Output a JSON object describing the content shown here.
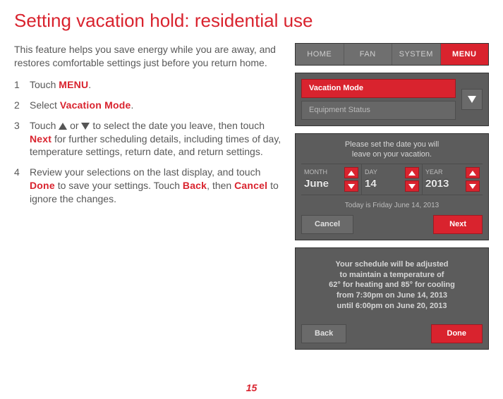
{
  "title": "Setting vacation hold: residential use",
  "intro": "This feature helps you save energy while you are away, and restores comfortable settings just before you return home.",
  "steps": {
    "s1": {
      "num": "1",
      "pre": "Touch ",
      "hl": "MENU",
      "post": "."
    },
    "s2": {
      "num": "2",
      "pre": "Select ",
      "hl": "Vacation Mode",
      "post": "."
    },
    "s3": {
      "num": "3",
      "preA": "Touch ",
      "midA": " or ",
      "postA": " to select the date you leave, then touch ",
      "hl": "Next",
      "postB": " for further scheduling details, including times of day, temperature settings, return date, and return settings."
    },
    "s4": {
      "num": "4",
      "preA": "Review your selections on the last display, and touch ",
      "hlA": "Done",
      "mid": " to save your settings. Touch ",
      "hlB": "Back",
      "mid2": ", then ",
      "hlC": "Cancel",
      "post": " to ignore the changes."
    }
  },
  "tabs": {
    "home": "HOME",
    "fan": "FAN",
    "system": "SYSTEM",
    "menu": "MENU"
  },
  "menu": {
    "vacation": "Vacation Mode",
    "equipment": "Equipment Status"
  },
  "date": {
    "prompt_l1": "Please set the date you will",
    "prompt_l2": "leave on your vacation.",
    "month_lbl": "MONTH",
    "month_val": "June",
    "day_lbl": "DAY",
    "day_val": "14",
    "year_lbl": "YEAR",
    "year_val": "2013",
    "today": "Today is Friday June 14, 2013",
    "cancel": "Cancel",
    "next": "Next"
  },
  "summary": {
    "l1": "Your schedule will be adjusted",
    "l2": "to maintain a temperature of",
    "l3": "62° for heating and 85° for cooling",
    "l4": "from 7:30pm on June 14, 2013",
    "l5": "until 6:00pm on June 20, 2013",
    "back": "Back",
    "done": "Done"
  },
  "page": "15"
}
